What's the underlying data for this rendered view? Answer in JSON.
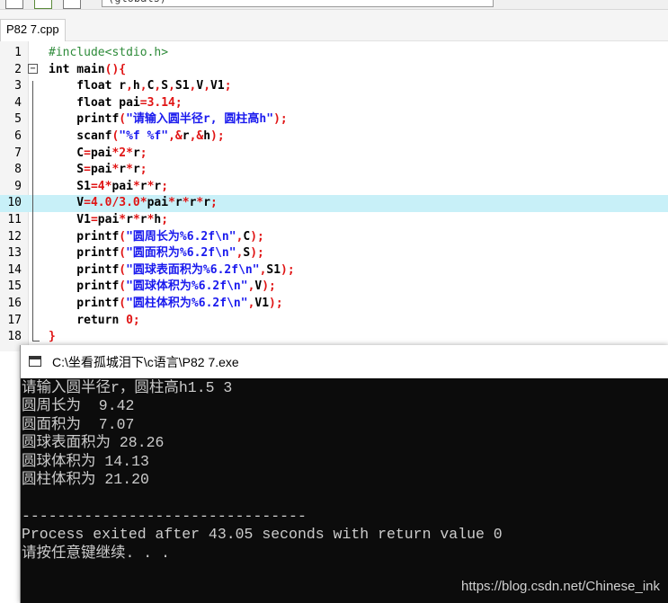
{
  "toolbar": {
    "scope_combo_text": "(globals)"
  },
  "tab": {
    "label": "P82 7.cpp"
  },
  "editor": {
    "highlight_line": 10,
    "lines": [
      {
        "n": "1",
        "code": "#include<stdio.h>"
      },
      {
        "n": "2",
        "code": "int main(){"
      },
      {
        "n": "3",
        "code": "    float r,h,C,S,S1,V,V1;"
      },
      {
        "n": "4",
        "code": "    float pai=3.14;"
      },
      {
        "n": "5",
        "code": "    printf(\"请输入圆半径r, 圆柱高h\");"
      },
      {
        "n": "6",
        "code": "    scanf(\"%f %f\",&r,&h);"
      },
      {
        "n": "7",
        "code": "    C=pai*2*r;"
      },
      {
        "n": "8",
        "code": "    S=pai*r*r;"
      },
      {
        "n": "9",
        "code": "    S1=4*pai*r*r;"
      },
      {
        "n": "10",
        "code": "    V=4.0/3.0*pai*r*r*r;"
      },
      {
        "n": "11",
        "code": "    V1=pai*r*r*h;"
      },
      {
        "n": "12",
        "code": "    printf(\"圆周长为%6.2f\\n\",C);"
      },
      {
        "n": "13",
        "code": "    printf(\"圆面积为%6.2f\\n\",S);"
      },
      {
        "n": "14",
        "code": "    printf(\"圆球表面积为%6.2f\\n\",S1);"
      },
      {
        "n": "15",
        "code": "    printf(\"圆球体积为%6.2f\\n\",V);"
      },
      {
        "n": "16",
        "code": "    printf(\"圆柱体积为%6.2f\\n\",V1);"
      },
      {
        "n": "17",
        "code": "    return 0;"
      },
      {
        "n": "18",
        "code": "}"
      }
    ]
  },
  "console": {
    "title": "C:\\坐看孤城泪下\\c语言\\P82 7.exe",
    "output": [
      "请输入圆半径r，圆柱高h1.5 3",
      "圆周长为  9.42",
      "圆面积为  7.07",
      "圆球表面积为 28.26",
      "圆球体积为 14.13",
      "圆柱体积为 21.20",
      "",
      "--------------------------------",
      "Process exited after 43.05 seconds with return value 0",
      "请按任意键继续. . ."
    ],
    "watermark": "https://blog.csdn.net/Chinese_ink"
  }
}
